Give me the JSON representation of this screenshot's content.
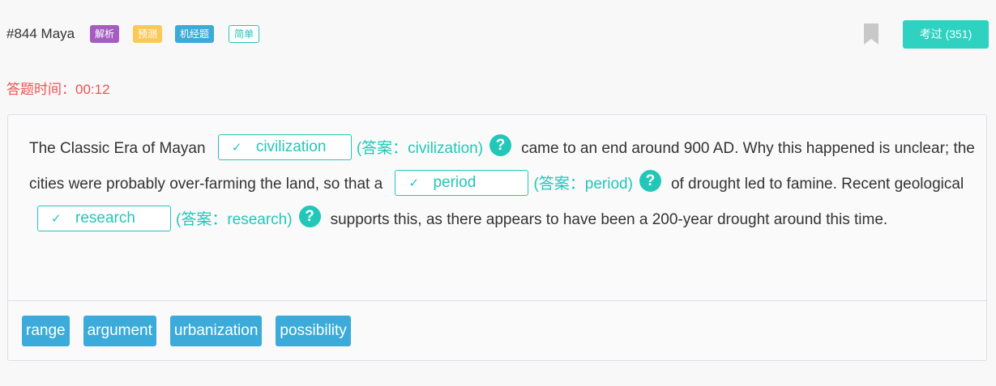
{
  "header": {
    "question_id": "#844 Maya",
    "tags": [
      "解析",
      "预测",
      "机经题",
      "简单"
    ],
    "passed_button": "考过 (351)"
  },
  "timer": {
    "label": "答题时间：",
    "value": "00:12"
  },
  "passage": {
    "s1": "The Classic Era of Mayan",
    "blank1": {
      "value": "civilization",
      "answer": "(答案：civilization)"
    },
    "s2": "came to an end around 900 AD. Why this happened is unclear; the cities were probably over-farming the land, so that a",
    "blank2": {
      "value": "period",
      "answer": "(答案：period)"
    },
    "s3": "of drought led to famine. Recent geological",
    "blank3": {
      "value": "research",
      "answer": "(答案：research)"
    },
    "s4": "supports this, as there appears to have been a 200-year drought around this time."
  },
  "options": [
    "range",
    "argument",
    "urbanization",
    "possibility"
  ],
  "colors": {
    "accent": "#22c7b8",
    "option_bg": "#3cabd9",
    "timer": "#f05252",
    "tag_analysis": "#a65dc2",
    "tag_predict": "#fbc95a",
    "tag_exam": "#3cabd9"
  }
}
